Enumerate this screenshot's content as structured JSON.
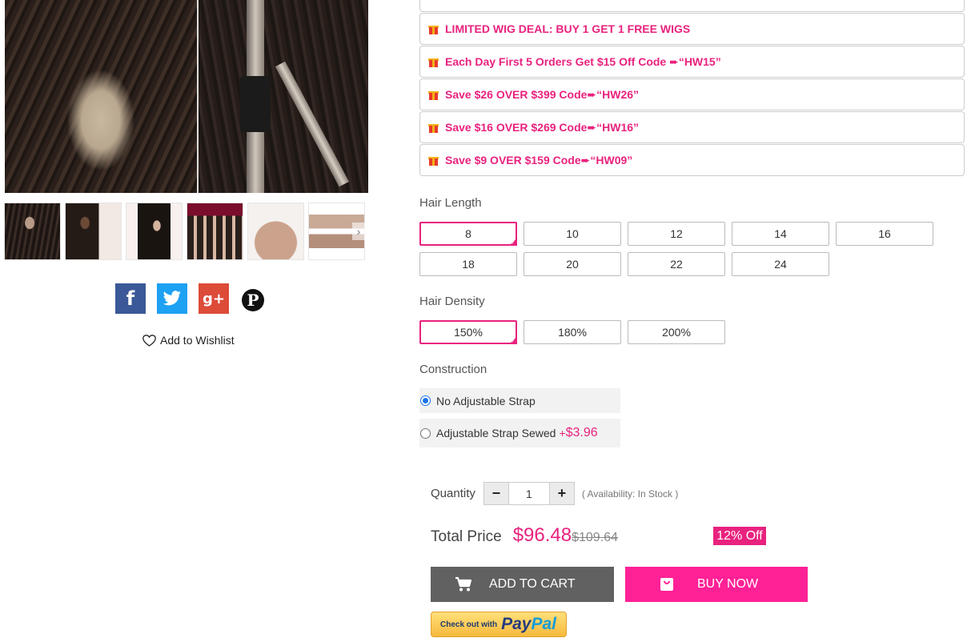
{
  "gallery": {
    "thumbnails": [
      "thumb-1",
      "thumb-2",
      "thumb-3",
      "thumb-4",
      "thumb-5",
      "thumb-6"
    ],
    "next_arrow": "›"
  },
  "share": {
    "facebook": "f",
    "google_plus": "g+",
    "pinterest": "P"
  },
  "wishlist": {
    "label": "Add to Wishlist"
  },
  "promos": [
    "LIMITED WIG DEAL: BUY 1 GET 1 FREE WIGS",
    "Each Day First 5 Orders Get $15 Off Code ➨“HW15”",
    "Save $26 OVER $399 Code➨“HW26”",
    "Save $16 OVER $269 Code➨“HW16”",
    "Save $9 OVER $159 Code➨“HW09”"
  ],
  "hair_length": {
    "label": "Hair Length",
    "options": [
      "8",
      "10",
      "12",
      "14",
      "16",
      "18",
      "20",
      "22",
      "24"
    ],
    "selected": "8"
  },
  "hair_density": {
    "label": "Hair Density",
    "options": [
      "150%",
      "180%",
      "200%"
    ],
    "selected": "150%"
  },
  "construction": {
    "label": "Construction",
    "options": [
      {
        "label": "No Adjustable Strap",
        "checked": true
      },
      {
        "label": "Adjustable Strap Sewed",
        "extra_prefix": "+",
        "extra_price": "$3.96",
        "checked": false
      }
    ]
  },
  "quantity": {
    "label": "Quantity",
    "minus": "−",
    "plus": "+",
    "value": "1",
    "availability": "( Availability: In Stock )"
  },
  "price": {
    "label": "Total Price",
    "current": "$96.48",
    "original": "$109.64",
    "discount_badge": "12% Off"
  },
  "actions": {
    "add_to_cart": "ADD TO CART",
    "buy_now": "BUY NOW"
  },
  "paypal": {
    "small_text": "Check out with",
    "brand_pay": "Pay",
    "brand_pal": "Pal"
  },
  "colors": {
    "accent": "#e8227e",
    "buy_now": "#ff2196",
    "cart_button": "#616161"
  }
}
